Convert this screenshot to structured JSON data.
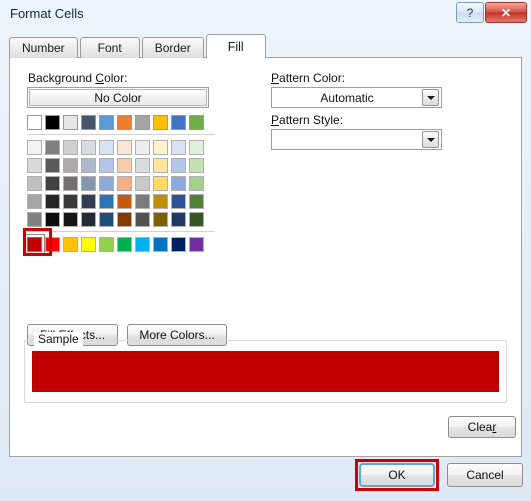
{
  "window": {
    "title": "Format Cells",
    "help_button": "?",
    "close_button": "✕"
  },
  "tabs": [
    {
      "label": "Number",
      "active": false
    },
    {
      "label": "Font",
      "active": false
    },
    {
      "label": "Border",
      "active": false
    },
    {
      "label": "Fill",
      "active": true
    }
  ],
  "background": {
    "label_pre": "Background ",
    "label_accel": "C",
    "label_post": "olor:",
    "no_color_label": "No Color",
    "theme_row": [
      "#FFFFFF",
      "#000000",
      "#E7E6E6",
      "#44546A",
      "#5B9BD5",
      "#ED7D31",
      "#A5A5A5",
      "#FFC000",
      "#4472C4",
      "#70AD47"
    ],
    "tint_rows": [
      [
        "#F2F2F2",
        "#808080",
        "#D0CECE",
        "#D6DCE4",
        "#D9E2F3",
        "#FBE5D5",
        "#EDEDED",
        "#FFF2CC",
        "#D9E2F3",
        "#E2EFD9"
      ],
      [
        "#D9D9D9",
        "#595959",
        "#AEAAAA",
        "#ADB9CA",
        "#B4C6E7",
        "#F8CBAD",
        "#DBDBDB",
        "#FFE599",
        "#B4C6E7",
        "#C5E0B3"
      ],
      [
        "#BFBFBF",
        "#404040",
        "#757070",
        "#8496B0",
        "#8EAADB",
        "#F4B083",
        "#C9C9C9",
        "#FFD965",
        "#8EAADB",
        "#A8D08D"
      ],
      [
        "#A6A6A6",
        "#262626",
        "#3B3838",
        "#323E4F",
        "#2E74B5",
        "#C55A11",
        "#7B7B7B",
        "#BF8F00",
        "#2F5496",
        "#538135"
      ],
      [
        "#808080",
        "#0D0D0D",
        "#171616",
        "#222A35",
        "#1F4E79",
        "#833C00",
        "#525252",
        "#7F6000",
        "#1F3864",
        "#375623"
      ]
    ],
    "standard_row": [
      "#C00000",
      "#FF0000",
      "#FFC000",
      "#FFFF00",
      "#92D050",
      "#00B050",
      "#00B0F0",
      "#0070C0",
      "#002060",
      "#7030A0"
    ],
    "selected_standard_index": 0,
    "fill_effects_pre": "F",
    "fill_effects_accel": "i",
    "fill_effects_post": "ll Effects...",
    "more_colors_accel": "M",
    "more_colors_post": "ore Colors..."
  },
  "pattern": {
    "color_label_accel": "P",
    "color_label_post": "attern Color:",
    "color_value": "Automatic",
    "style_label_accel": "P",
    "style_label_post": "attern Style:",
    "style_value": ""
  },
  "sample": {
    "title": "Sample",
    "fill_color": "#C00000"
  },
  "buttons": {
    "clear_pre": "Clea",
    "clear_accel": "r",
    "ok": "OK",
    "cancel": "Cancel"
  },
  "annotations": {
    "accent_color": "#CC0000"
  }
}
